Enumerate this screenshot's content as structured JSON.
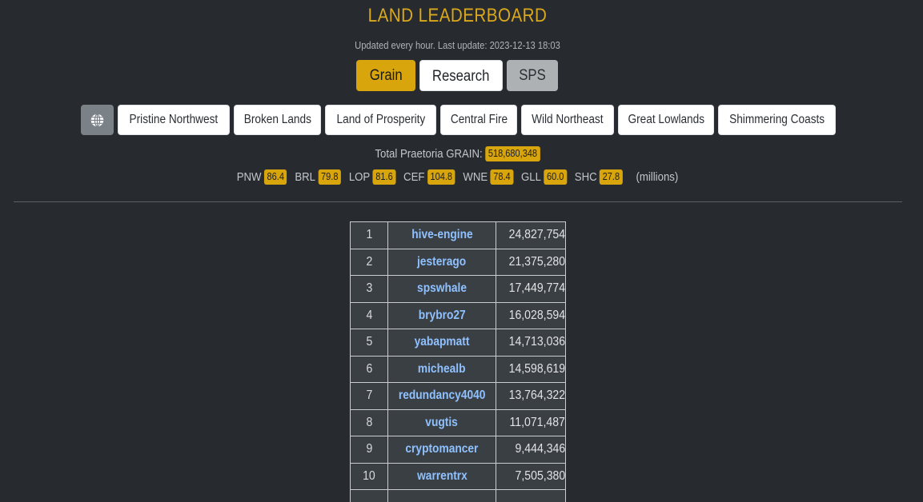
{
  "header": {
    "title": "LAND LEADERBOARD",
    "updated": "Updated every hour. Last update: 2023-12-13 18:03"
  },
  "tabs": [
    {
      "label": "Grain",
      "active": true
    },
    {
      "label": "Research",
      "active": false
    },
    {
      "label": "SPS",
      "active": false
    }
  ],
  "regions": {
    "globe_icon": "globe-icon",
    "items": [
      "Pristine Northwest",
      "Broken Lands",
      "Land of Prosperity",
      "Central Fire",
      "Wild Northeast",
      "Great Lowlands",
      "Shimmering Coasts"
    ]
  },
  "totals": {
    "label": "Total Praetoria GRAIN:",
    "value": "518,680,348"
  },
  "stats": {
    "items": [
      {
        "code": "PNW",
        "value": "86.4"
      },
      {
        "code": "BRL",
        "value": "79.8"
      },
      {
        "code": "LOP",
        "value": "81.6"
      },
      {
        "code": "CEF",
        "value": "104.8"
      },
      {
        "code": "WNE",
        "value": "78.4"
      },
      {
        "code": "GLL",
        "value": "60.0"
      },
      {
        "code": "SHC",
        "value": "27.8"
      }
    ],
    "unit": "(millions)"
  },
  "leaderboard": {
    "rows": [
      {
        "rank": "1",
        "user": "hive-engine",
        "amount": "24,827,754"
      },
      {
        "rank": "2",
        "user": "jesterago",
        "amount": "21,375,280"
      },
      {
        "rank": "3",
        "user": "spswhale",
        "amount": "17,449,774"
      },
      {
        "rank": "4",
        "user": "brybro27",
        "amount": "16,028,594"
      },
      {
        "rank": "5",
        "user": "yabapmatt",
        "amount": "14,713,036"
      },
      {
        "rank": "6",
        "user": "michealb",
        "amount": "14,598,619"
      },
      {
        "rank": "7",
        "user": "redundancy4040",
        "amount": "13,764,322"
      },
      {
        "rank": "8",
        "user": "vugtis",
        "amount": "11,071,487"
      },
      {
        "rank": "9",
        "user": "cryptomancer",
        "amount": "9,444,346"
      },
      {
        "rank": "10",
        "user": "warrentrx",
        "amount": "7,505,380"
      }
    ]
  },
  "colors": {
    "background": "#272b30",
    "accent": "#d8a50c",
    "link": "#8fc1ff"
  }
}
